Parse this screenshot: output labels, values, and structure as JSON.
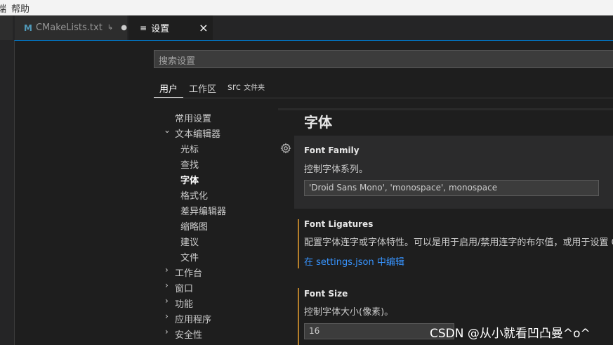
{
  "menubar": {
    "items": [
      "端",
      "帮助"
    ]
  },
  "tabs": [
    {
      "icon": "M",
      "label": "CMakeLists.txt",
      "dirty_glyph": "↳",
      "dot": "●"
    },
    {
      "icon": "≡",
      "label": "设置",
      "close": "×"
    }
  ],
  "search": {
    "placeholder": "搜索设置"
  },
  "scopes": {
    "user": "用户",
    "workspace": "工作区",
    "folder": "src",
    "folder_suffix": "文件夹"
  },
  "toc": [
    {
      "label": "常用设置",
      "chev": ""
    },
    {
      "label": "文本编辑器",
      "chev": "⌄"
    },
    {
      "label": "光标"
    },
    {
      "label": "查找"
    },
    {
      "label": "字体"
    },
    {
      "label": "格式化"
    },
    {
      "label": "差异编辑器"
    },
    {
      "label": "缩略图"
    },
    {
      "label": "建议"
    },
    {
      "label": "文件"
    },
    {
      "label": "工作台",
      "chev": "›"
    },
    {
      "label": "窗口",
      "chev": "›"
    },
    {
      "label": "功能",
      "chev": "›"
    },
    {
      "label": "应用程序",
      "chev": "›"
    },
    {
      "label": "安全性",
      "chev": "›"
    }
  ],
  "section": {
    "title": "字体"
  },
  "settings": {
    "font_family": {
      "title": "Font Family",
      "desc": "控制字体系列。",
      "value": "'Droid Sans Mono', 'monospace', monospace"
    },
    "font_ligatures": {
      "title": "Font Ligatures",
      "desc": "配置字体连字或字体特性。可以是用于启用/禁用连字的布尔值，或用于设置 C",
      "link": "在 settings.json 中编辑"
    },
    "font_size": {
      "title": "Font Size",
      "desc": "控制字体大小(像素)。",
      "value": "16"
    }
  },
  "watermark": "CSDN @从小就看凹凸曼^o^",
  "colors": {
    "accent": "#007acc",
    "modified": "#b67f2a",
    "link": "#3794ff"
  }
}
